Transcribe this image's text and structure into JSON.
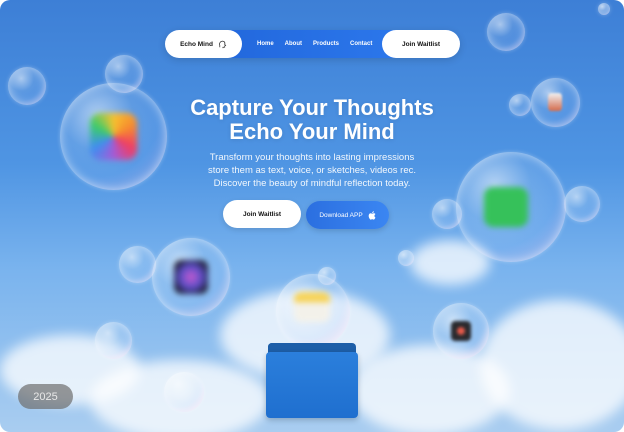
{
  "nav": {
    "brand": "Echo Mind",
    "links": [
      "Home",
      "About",
      "Products",
      "Contact"
    ],
    "join_label": "Join Waitlist"
  },
  "hero": {
    "title_line1": "Capture Your Thoughts",
    "title_line2": "Echo Your Mind",
    "subtitle_line1": "Transform your thoughts into lasting impressions",
    "subtitle_line2": "store them as text, voice, or sketches, videos rec.",
    "subtitle_line3": "Discover the beauty of mindful reflection today.",
    "primary_cta": "Join Waitlist",
    "secondary_cta": "Download APP"
  },
  "year_badge": "2025",
  "icons": [
    "photos-app-icon",
    "facetime-app-icon",
    "siri-app-icon",
    "notes-app-icon",
    "screen-recorder-app-icon",
    "folder-icon",
    "apple-icon",
    "rocket-app-icon"
  ],
  "colors": {
    "accent": "#2f7cf0",
    "background_top": "#3d7fd6",
    "background_bottom": "#a9cdf0"
  }
}
